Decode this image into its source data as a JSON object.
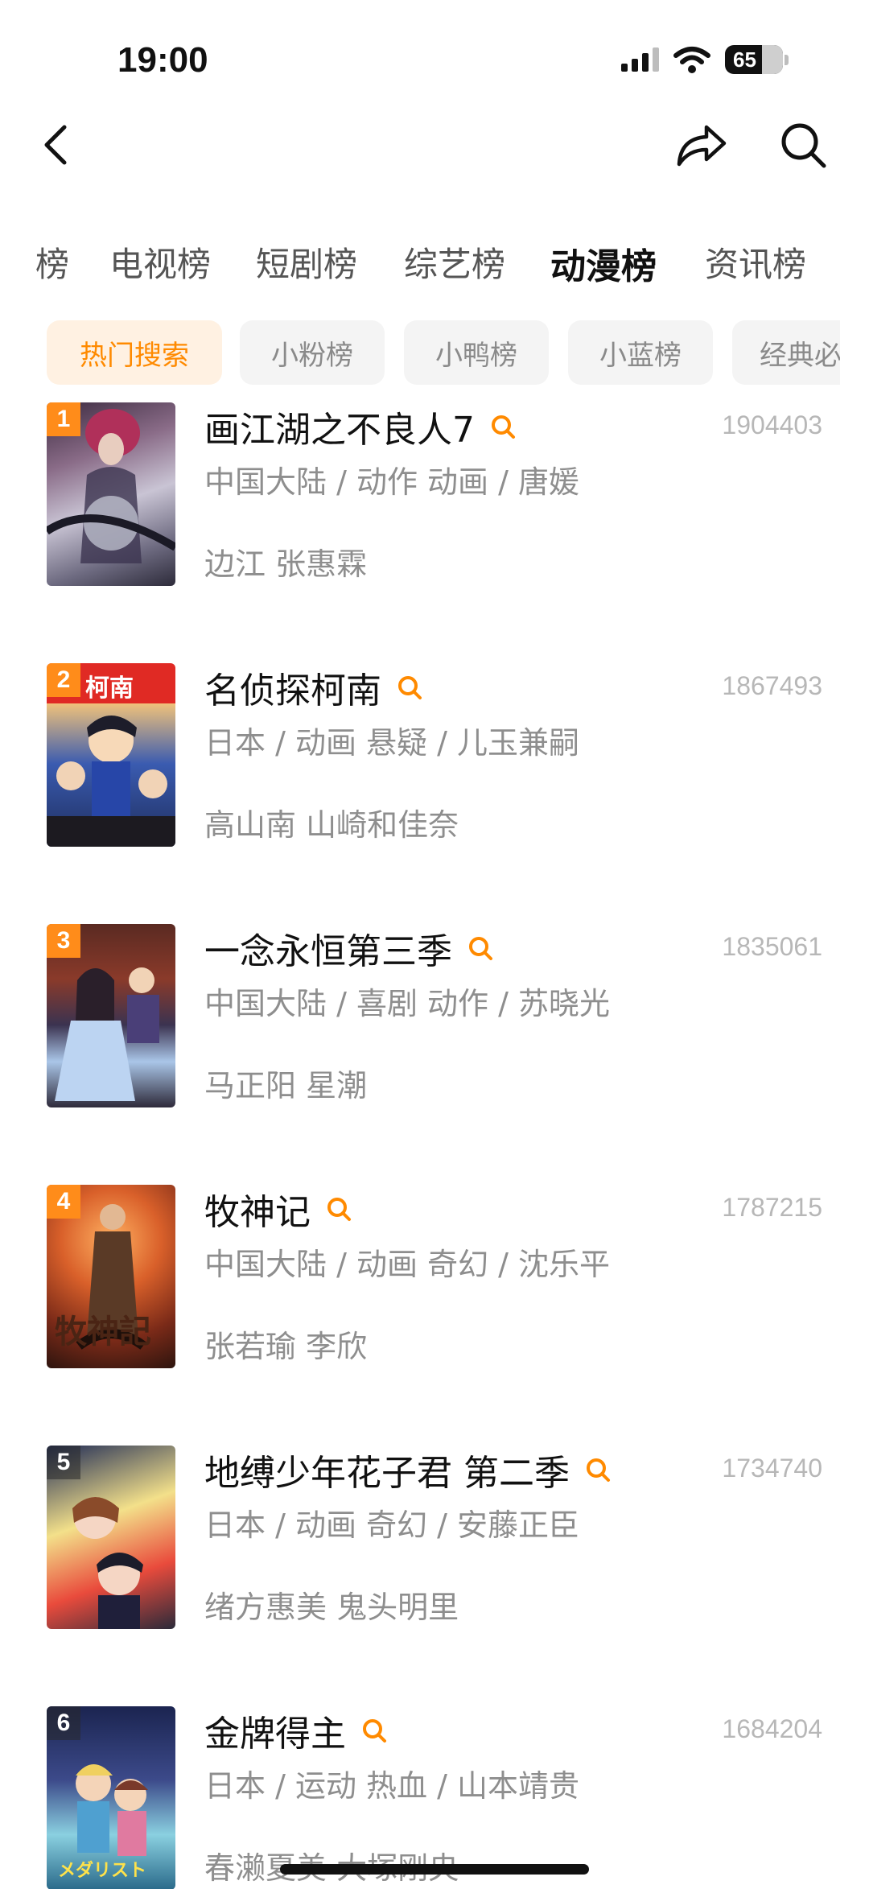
{
  "status": {
    "time": "19:00",
    "battery": "65"
  },
  "nav": {
    "back_icon": "chevron-left-icon",
    "share_icon": "share-icon",
    "search_icon": "search-icon"
  },
  "tabs": [
    "榜",
    "电视榜",
    "短剧榜",
    "综艺榜",
    "动漫榜",
    "资讯榜"
  ],
  "active_tab": "动漫榜",
  "chips": [
    "热门搜索",
    "小粉榜",
    "小鸭榜",
    "小蓝榜",
    "经典必"
  ],
  "active_chip": "热门搜索",
  "colors": {
    "accent": "#ff8a00",
    "chip_active_bg": "#fff1e2",
    "rank_badge": "#ff8c1a"
  },
  "items": [
    {
      "rank": "1",
      "title": "画江湖之不良人7",
      "score": "1904403",
      "meta": "中国大陆 / 动作 动画 / 唐媛",
      "cast": "边江 张惠霖"
    },
    {
      "rank": "2",
      "title": "名侦探柯南",
      "score": "1867493",
      "meta": "日本 / 动画 悬疑 / 儿玉兼嗣",
      "cast": "高山南 山崎和佳奈",
      "poster_text": "柯南"
    },
    {
      "rank": "3",
      "title": "一念永恒第三季",
      "score": "1835061",
      "meta": "中国大陆 / 喜剧 动作 / 苏晓光",
      "cast": "马正阳 星潮"
    },
    {
      "rank": "4",
      "title": "牧神记",
      "score": "1787215",
      "meta": "中国大陆 / 动画 奇幻 / 沈乐平",
      "cast": "张若瑜 李欣",
      "poster_text": "牧神記"
    },
    {
      "rank": "5",
      "title": "地缚少年花子君 第二季",
      "score": "1734740",
      "meta": "日本 / 动画 奇幻 / 安藤正臣",
      "cast": "绪方惠美 鬼头明里"
    },
    {
      "rank": "6",
      "title": "金牌得主",
      "score": "1684204",
      "meta": "日本 / 运动 热血 / 山本靖贵",
      "cast": "春濑夏美 大塚刚央",
      "poster_text": "メダリスト"
    }
  ]
}
